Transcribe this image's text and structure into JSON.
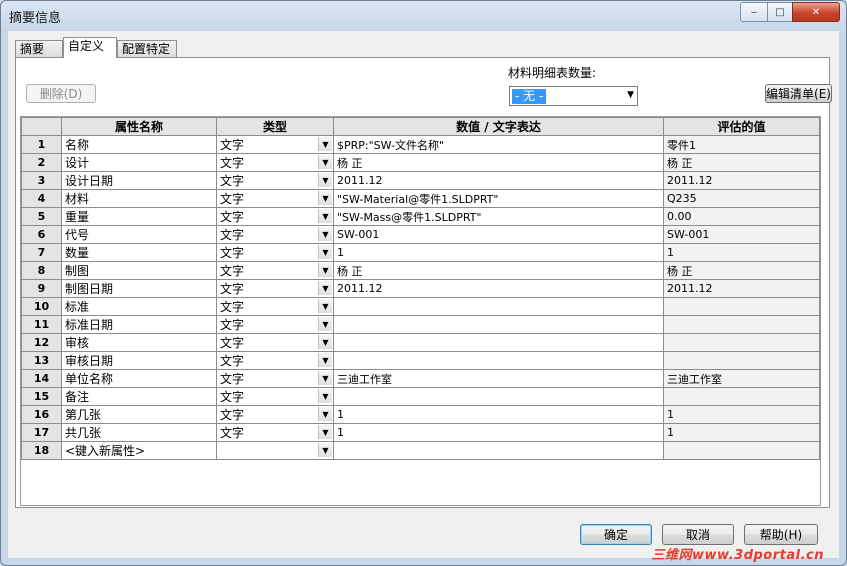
{
  "window": {
    "title": "摘要信息",
    "min_glyph": "‒",
    "max_glyph": "□",
    "close_glyph": "✕"
  },
  "tabs": [
    "摘要",
    "自定义",
    "配置特定"
  ],
  "toolbar": {
    "delete_label": "删除(D)",
    "bom_label": "材料明细表数量:",
    "bom_value": "- 无 -",
    "edit_list_label": "编辑清单(E)"
  },
  "table": {
    "headers": [
      "属性名称",
      "类型",
      "数值 / 文字表达",
      "评估的值"
    ],
    "rows": [
      {
        "num": "1",
        "name": "名称",
        "type": "文字",
        "value": "$PRP:\"SW-文件名称\"",
        "eval": "零件1"
      },
      {
        "num": "2",
        "name": "设计",
        "type": "文字",
        "value": "杨 正",
        "eval": "杨 正"
      },
      {
        "num": "3",
        "name": "设计日期",
        "type": "文字",
        "value": "2011.12",
        "eval": "2011.12"
      },
      {
        "num": "4",
        "name": "材料",
        "type": "文字",
        "value": "\"SW-Material@零件1.SLDPRT\"",
        "eval": "Q235"
      },
      {
        "num": "5",
        "name": "重量",
        "type": "文字",
        "value": "\"SW-Mass@零件1.SLDPRT\"",
        "eval": "0.00"
      },
      {
        "num": "6",
        "name": "代号",
        "type": "文字",
        "value": "SW-001",
        "eval": "SW-001"
      },
      {
        "num": "7",
        "name": "数量",
        "type": "文字",
        "value": "1",
        "eval": "1"
      },
      {
        "num": "8",
        "name": "制图",
        "type": "文字",
        "value": "杨 正",
        "eval": "杨 正"
      },
      {
        "num": "9",
        "name": "制图日期",
        "type": "文字",
        "value": "2011.12",
        "eval": "2011.12"
      },
      {
        "num": "10",
        "name": "标准",
        "type": "文字",
        "value": "",
        "eval": ""
      },
      {
        "num": "11",
        "name": "标准日期",
        "type": "文字",
        "value": "",
        "eval": ""
      },
      {
        "num": "12",
        "name": "审核",
        "type": "文字",
        "value": "",
        "eval": ""
      },
      {
        "num": "13",
        "name": "审核日期",
        "type": "文字",
        "value": "",
        "eval": ""
      },
      {
        "num": "14",
        "name": "单位名称",
        "type": "文字",
        "value": "三迪工作室",
        "eval": "三迪工作室"
      },
      {
        "num": "15",
        "name": "备注",
        "type": "文字",
        "value": "",
        "eval": ""
      },
      {
        "num": "16",
        "name": "第几张",
        "type": "文字",
        "value": "1",
        "eval": "1"
      },
      {
        "num": "17",
        "name": "共几张",
        "type": "文字",
        "value": "1",
        "eval": "1"
      },
      {
        "num": "18",
        "name": "<键入新属性>",
        "type": "",
        "value": "",
        "eval": ""
      }
    ]
  },
  "footer": {
    "ok": "确定",
    "cancel": "取消",
    "help": "帮助(H)"
  },
  "watermark": "三维网www.3dportal.cn"
}
